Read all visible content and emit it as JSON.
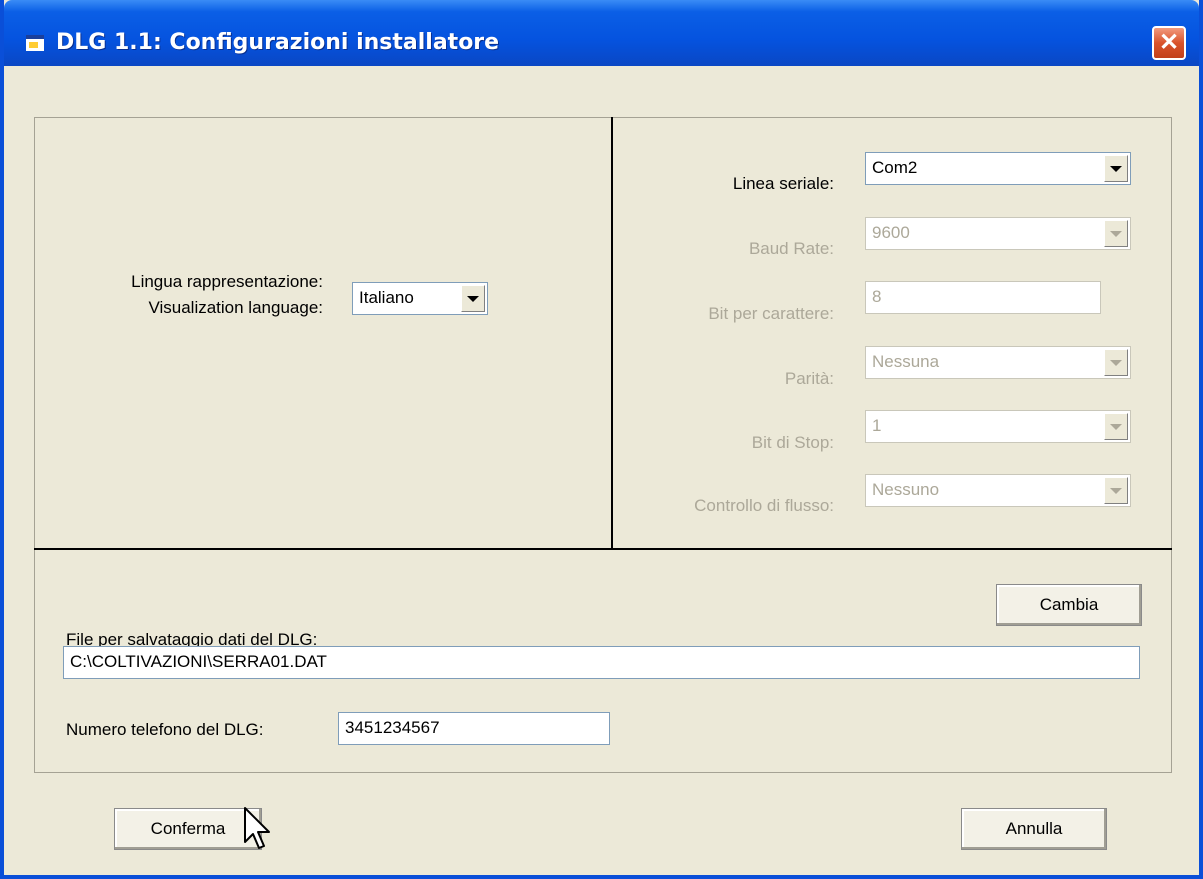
{
  "window": {
    "title": "DLG 1.1: Configurazioni installatore",
    "close_glyph": "✕",
    "accent": "#0553df",
    "close_color": "#d9532c"
  },
  "language": {
    "label_line1": "Lingua rappresentazione:",
    "label_line2": "Visualization language:",
    "value": "Italiano"
  },
  "serial": {
    "port_label": "Linea seriale:",
    "port_value": "Com2",
    "baud_label": "Baud Rate:",
    "baud_value": "9600",
    "bits_label": "Bit per carattere:",
    "bits_value": "8",
    "parity_label": "Parità:",
    "parity_value": "Nessuna",
    "stop_label": "Bit di Stop:",
    "stop_value": "1",
    "flow_label": "Controllo di flusso:",
    "flow_value": "Nessuno"
  },
  "file": {
    "label": "File per salvataggio dati del DLG:",
    "change_button": "Cambia",
    "path": "C:\\COLTIVAZIONI\\SERRA01.DAT"
  },
  "phone": {
    "label": "Numero telefono del DLG:",
    "value": "3451234567"
  },
  "footer": {
    "confirm": "Conferma",
    "cancel": "Annulla"
  },
  "icons": {
    "app": "window-app-icon",
    "close": "close-icon",
    "dropdown": "chevron-down-icon",
    "cursor": "mouse-cursor-icon"
  }
}
